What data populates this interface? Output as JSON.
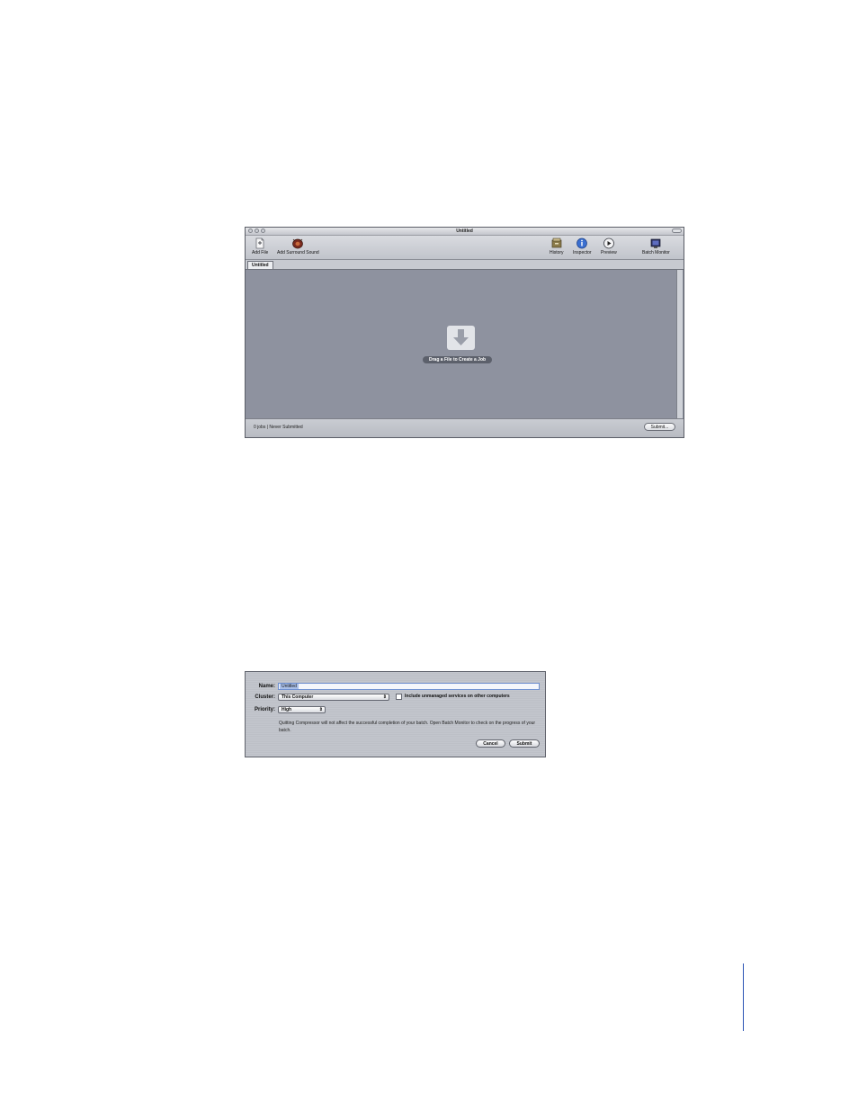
{
  "main_window": {
    "title": "Untitled",
    "toolbar": {
      "add_file": {
        "label": "Add File",
        "icon": "add-file-icon"
      },
      "add_surround": {
        "label": "Add Surround Sound",
        "icon": "surround-sound-icon"
      },
      "history": {
        "label": "History",
        "icon": "history-icon"
      },
      "inspector": {
        "label": "Inspector",
        "icon": "info-icon"
      },
      "preview": {
        "label": "Preview",
        "icon": "play-icon"
      },
      "batch_monitor": {
        "label": "Batch Monitor",
        "icon": "monitor-icon"
      }
    },
    "tab_label": "Untitled",
    "drop_prompt": "Drag a File to Create a Job",
    "status": "0 jobs  |  Never Submitted",
    "submit_button": "Submit..."
  },
  "submit_dialog": {
    "name_label": "Name:",
    "name_value": "Untitled",
    "cluster_label": "Cluster:",
    "cluster_value": "This Computer",
    "include_checkbox_label": "Include unmanaged services on other computers",
    "priority_label": "Priority:",
    "priority_value": "High",
    "note": "Quitting Compressor will not affect the successful completion of your batch. Open Batch Monitor to check on the progress of your batch.",
    "cancel_button": "Cancel",
    "submit_button": "Submit"
  },
  "colors": {
    "batch_area": "#8e929f",
    "selection": "#a9bfe8",
    "page_rule": "#2a52b4"
  }
}
